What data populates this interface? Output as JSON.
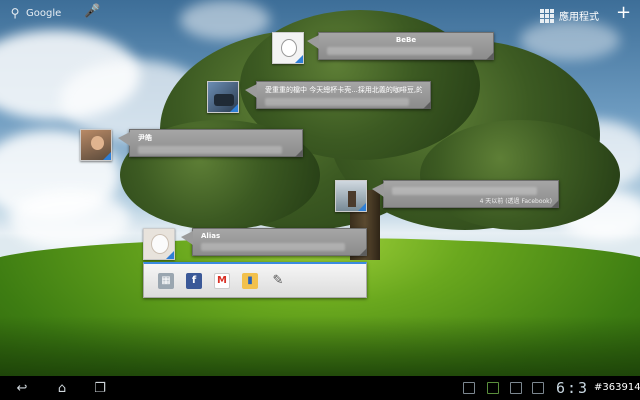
{
  "search": {
    "label": "Google"
  },
  "apps": {
    "label": "應用程式"
  },
  "posts": [
    {
      "name": "BeBe",
      "text": "",
      "meta": ""
    },
    {
      "name": "",
      "text": "愛重重的檔中 今天總杯卡壳...採用北義的咖啡豆,的確不",
      "meta": ""
    },
    {
      "name": "尹皓",
      "text": "",
      "meta": ""
    },
    {
      "name": "",
      "text": "",
      "meta": "4 天以前 (透過 Facebook)"
    },
    {
      "name": "Alias",
      "text": "",
      "meta": ""
    }
  ],
  "share_icons": [
    "gallery-icon",
    "facebook-icon",
    "gmail-icon",
    "contacts-icon",
    "settings-wrench-icon"
  ],
  "clock": {
    "time": "6:3"
  },
  "watermark": {
    "text": "#363914"
  },
  "colors": {
    "accent": "#3b8be0",
    "facebook": "#3b5998",
    "gmail": "#d93025"
  }
}
